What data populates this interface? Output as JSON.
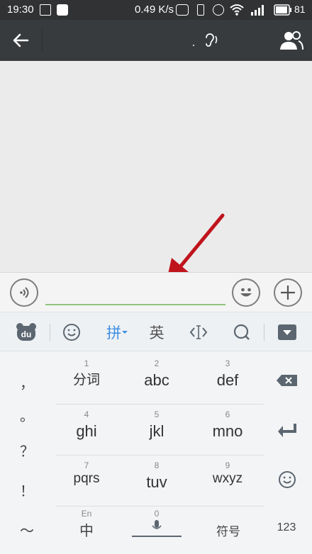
{
  "status_bar": {
    "time": "19:30",
    "speed": "0.49 K/s",
    "battery": "81"
  },
  "title_bar": {
    "back_icon": "back-arrow-icon",
    "contacts_icon": "people-icon",
    "subtitle_icon": "ear-icon"
  },
  "input_bar": {
    "voice_icon": "voice-icon",
    "emoji_icon": "emoji-icon",
    "add_icon": "plus-icon",
    "text_value": ""
  },
  "kb_toolbar": {
    "logo": "du",
    "pinyin": "拼",
    "english": "英"
  },
  "keyboard": {
    "punctuation": [
      "，",
      "。",
      "？",
      "！",
      "～"
    ],
    "rows": [
      [
        {
          "num": "1",
          "label": "分词"
        },
        {
          "num": "2",
          "label": "abc"
        },
        {
          "num": "3",
          "label": "def"
        }
      ],
      [
        {
          "num": "4",
          "label": "ghi"
        },
        {
          "num": "5",
          "label": "jkl"
        },
        {
          "num": "6",
          "label": "mno"
        }
      ],
      [
        {
          "num": "7",
          "label": "pqrs"
        },
        {
          "num": "8",
          "label": "tuv"
        },
        {
          "num": "9",
          "label": "wxyz"
        }
      ]
    ],
    "bottom": {
      "lang_small": "En",
      "lang_main": "中",
      "space_num": "0",
      "symbols": "符号",
      "numbers": "123"
    }
  },
  "colors": {
    "title_bar": "#383b3d",
    "input_underline": "#8fc37a",
    "pinyin_accent": "#3f8ee6",
    "arrow": "#c0141c"
  }
}
